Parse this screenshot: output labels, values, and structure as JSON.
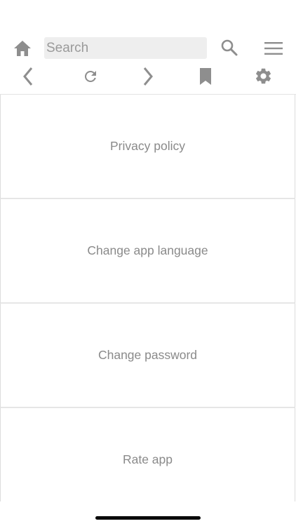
{
  "header": {
    "search": {
      "placeholder": "Search",
      "value": ""
    },
    "icons": {
      "home": "home-icon",
      "search": "search-icon",
      "menu": "menu-icon"
    }
  },
  "navbar": {
    "icons": {
      "back": "chevron-left-icon",
      "refresh": "refresh-icon",
      "forward": "chevron-right-icon",
      "bookmark": "bookmark-icon",
      "settings": "gear-icon"
    }
  },
  "menu": {
    "items": [
      {
        "label": "Privacy policy"
      },
      {
        "label": "Change app language"
      },
      {
        "label": "Change password"
      },
      {
        "label": "Rate app"
      }
    ]
  },
  "colors": {
    "icon": "#8e8e8e",
    "text": "#8a8a8a",
    "search_bg": "#eeeeee",
    "divider": "#e3e3e3",
    "home_indicator": "#0a0a0a"
  }
}
